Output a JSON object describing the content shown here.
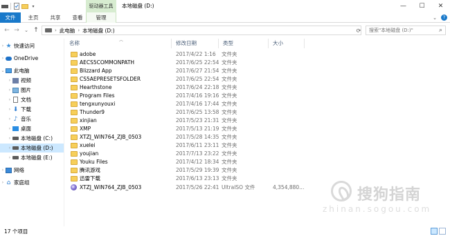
{
  "titlebar": {
    "context_group": "驱动器工具",
    "title": "本地磁盘 (D:)",
    "minimize": "—",
    "maximize": "☐",
    "close": "✕"
  },
  "ribbon": {
    "tabs": [
      "文件",
      "主页",
      "共享",
      "查看",
      "管理"
    ],
    "expand": "⌄",
    "help": "?"
  },
  "address": {
    "back": "←",
    "forward": "→",
    "recent": "⌄",
    "up": "↑",
    "crumbs": [
      "此电脑",
      "本地磁盘 (D:)"
    ],
    "search_placeholder": "搜索\"本地磁盘 (D:)\"",
    "search_icon": "⌕"
  },
  "nav": {
    "items": [
      {
        "label": "快速访问",
        "icon": "star-icon"
      },
      {
        "label": "OneDrive",
        "icon": "cloud-icon"
      },
      {
        "label": "此电脑",
        "icon": "computer-icon"
      },
      {
        "label": "视频",
        "icon": "video-icon"
      },
      {
        "label": "图片",
        "icon": "pictures-icon"
      },
      {
        "label": "文档",
        "icon": "document-icon"
      },
      {
        "label": "下载",
        "icon": "download-icon"
      },
      {
        "label": "音乐",
        "icon": "music-icon"
      },
      {
        "label": "桌面",
        "icon": "desktop-icon"
      },
      {
        "label": "本地磁盘 (C:)",
        "icon": "drive-icon"
      },
      {
        "label": "本地磁盘 (D:)",
        "icon": "drive-icon"
      },
      {
        "label": "本地磁盘 (E:)",
        "icon": "drive-icon"
      },
      {
        "label": "网络",
        "icon": "network-icon"
      },
      {
        "label": "家庭组",
        "icon": "homegroup-icon"
      }
    ]
  },
  "columns": {
    "name": "名称",
    "date": "修改日期",
    "type": "类型",
    "size": "大小"
  },
  "files": [
    {
      "name": "adobe",
      "date": "2017/4/22 1:16",
      "type": "文件夹",
      "size": "",
      "icon": "folder-icon"
    },
    {
      "name": "AECS5COMMONPATH",
      "date": "2017/6/25 22:54",
      "type": "文件夹",
      "size": "",
      "icon": "folder-icon"
    },
    {
      "name": "Blizzard App",
      "date": "2017/6/27 21:54",
      "type": "文件夹",
      "size": "",
      "icon": "folder-icon"
    },
    {
      "name": "CS5AEPRESETSFOLDER",
      "date": "2017/6/25 22:54",
      "type": "文件夹",
      "size": "",
      "icon": "folder-icon"
    },
    {
      "name": "Hearthstone",
      "date": "2017/6/24 22:18",
      "type": "文件夹",
      "size": "",
      "icon": "folder-icon"
    },
    {
      "name": "Program Files",
      "date": "2017/4/16 19:16",
      "type": "文件夹",
      "size": "",
      "icon": "folder-icon"
    },
    {
      "name": "tengxunyouxi",
      "date": "2017/4/16 17:44",
      "type": "文件夹",
      "size": "",
      "icon": "folder-icon"
    },
    {
      "name": "Thunder9",
      "date": "2017/6/25 13:58",
      "type": "文件夹",
      "size": "",
      "icon": "folder-icon"
    },
    {
      "name": "xinjian",
      "date": "2017/5/23 21:31",
      "type": "文件夹",
      "size": "",
      "icon": "folder-icon"
    },
    {
      "name": "XMP",
      "date": "2017/5/13 21:19",
      "type": "文件夹",
      "size": "",
      "icon": "folder-icon"
    },
    {
      "name": "XTZJ_WIN764_ZJB_0503",
      "date": "2017/5/28 14:35",
      "type": "文件夹",
      "size": "",
      "icon": "folder-icon"
    },
    {
      "name": "xuelei",
      "date": "2017/6/11 23:11",
      "type": "文件夹",
      "size": "",
      "icon": "folder-icon"
    },
    {
      "name": "youjian",
      "date": "2017/7/13 23:22",
      "type": "文件夹",
      "size": "",
      "icon": "folder-icon"
    },
    {
      "name": "Youku Files",
      "date": "2017/4/12 18:34",
      "type": "文件夹",
      "size": "",
      "icon": "folder-icon"
    },
    {
      "name": "腾讯游戏",
      "date": "2017/5/29 19:39",
      "type": "文件夹",
      "size": "",
      "icon": "folder-icon"
    },
    {
      "name": "迅雷下载",
      "date": "2017/6/13 23:13",
      "type": "文件夹",
      "size": "",
      "icon": "folder-icon"
    },
    {
      "name": "XTZJ_WIN764_ZJB_0503",
      "date": "2017/5/26 22:41",
      "type": "UltraISO 文件",
      "size": "4,354,880...",
      "icon": "iso-file-icon"
    }
  ],
  "watermark": {
    "cn": "搜狗指南",
    "en": "zhinan.sogou.com"
  },
  "status": {
    "count": "17 个项目"
  }
}
